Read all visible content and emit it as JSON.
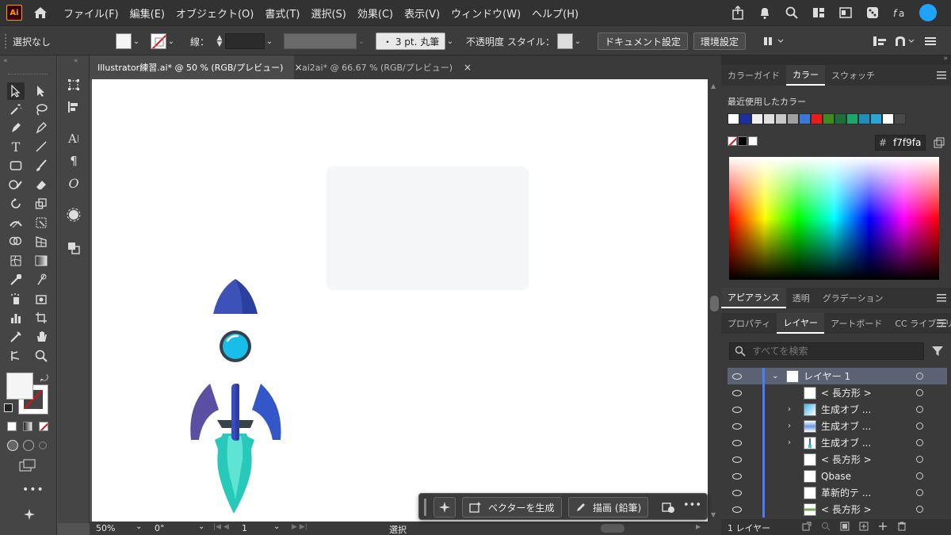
{
  "app": {
    "logo_text": "Ai"
  },
  "menu": [
    "ファイル(F)",
    "編集(E)",
    "オブジェクト(O)",
    "書式(T)",
    "選択(S)",
    "効果(C)",
    "表示(V)",
    "ウィンドウ(W)",
    "ヘルプ(H)"
  ],
  "control": {
    "selection": "選択なし",
    "stroke_label": "線：",
    "brush": "・ 3 pt. 丸筆",
    "opacity_label": "不透明度",
    "style_label": "スタイル：",
    "doc_settings": "ドキュメント設定",
    "prefs": "環境設定"
  },
  "tabs": [
    {
      "label": "Illustrator練習.ai* @ 50 % (RGB/プレビュー)",
      "close": "×"
    },
    {
      "label": "ai2ai* @ 66.67 % (RGB/プレビュー)",
      "close": "×"
    }
  ],
  "status": {
    "zoom": "50%",
    "rotate": "0°",
    "artboard": "1",
    "tool": "選択"
  },
  "taskbar": {
    "vector_btn": "ベクターを生成",
    "draw_btn": "描画 (鉛筆)",
    "more": "•••"
  },
  "color_panel": {
    "tabs": [
      "カラーガイド",
      "カラー",
      "スウォッチ"
    ],
    "recent_label": "最近使用したカラー",
    "hex_prefix": "#",
    "hex_value": "f7f9fa",
    "recent_colors": [
      "#ffffff",
      "#1a2fa0",
      "#f0f0f0",
      "#e0e0e0",
      "#c8c8c8",
      "#a0a0a0",
      "#3a78d8",
      "#e81c1c",
      "#3d8a1e",
      "#1d6f3a",
      "#1aa86a",
      "#1e8fb8",
      "#2aa6d6",
      "#ffffff",
      "#4a4a4a"
    ]
  },
  "appearance_tabs": [
    "アピアランス",
    "透明",
    "グラデーション"
  ],
  "layers_panel": {
    "tabs": [
      "プロパティ",
      "レイヤー",
      "アートボード",
      "CC ライブラリ"
    ],
    "search_placeholder": "すべてを検索",
    "rows": [
      {
        "name": "レイヤー 1",
        "twisty": "⌄"
      },
      {
        "name": "< 長方形 >",
        "twisty": ""
      },
      {
        "name": "生成オブ ...",
        "twisty": "›"
      },
      {
        "name": "生成オブ ...",
        "twisty": "›"
      },
      {
        "name": "生成オブ ...",
        "twisty": "›"
      },
      {
        "name": "< 長方形 >",
        "twisty": ""
      },
      {
        "name": "Qbase",
        "twisty": ""
      },
      {
        "name": "革新的テ ...",
        "twisty": ""
      },
      {
        "name": "< 長方形 >",
        "twisty": ""
      }
    ],
    "footer": "1 レイヤー"
  }
}
